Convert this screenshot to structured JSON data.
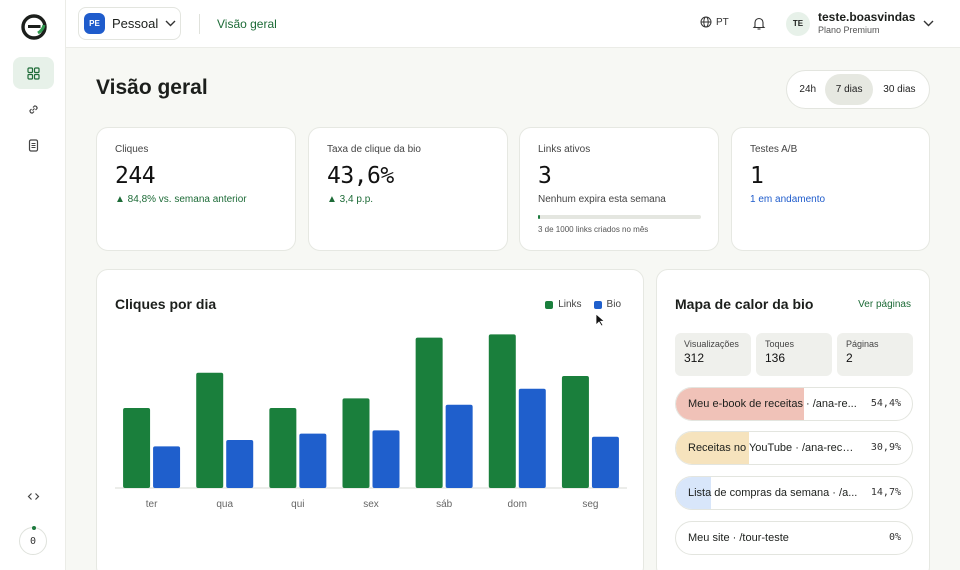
{
  "workspace": {
    "badge": "PE",
    "name": "Pessoal"
  },
  "breadcrumb": "Visão geral",
  "language": "PT",
  "user": {
    "initials": "TE",
    "username": "teste.boasvindas",
    "plan": "Plano Premium"
  },
  "sidebar": {
    "counter": "0"
  },
  "page": {
    "title": "Visão geral"
  },
  "range": {
    "options": [
      "24h",
      "7 dias",
      "30 dias"
    ],
    "selected": "7 dias"
  },
  "stats": [
    {
      "label": "Cliques",
      "value": "244",
      "sub": "▲ 84,8% vs. semana anterior"
    },
    {
      "label": "Taxa de clique da bio",
      "value": "43,6%",
      "sub": "▲ 3,4 p.p."
    },
    {
      "label": "Links ativos",
      "value": "3",
      "sub": "Nenhum expira esta semana",
      "progress": 0.003,
      "note": "3 de 1000 links criados no mês"
    },
    {
      "label": "Testes A/B",
      "value": "1",
      "sub": "1 em andamento"
    }
  ],
  "colors": {
    "links": "#1a7f3c",
    "bio": "#1f5fcc",
    "accent": "#1d6b37"
  },
  "chart_data": {
    "type": "bar",
    "title": "Cliques por dia",
    "categories": [
      "ter",
      "qua",
      "qui",
      "sex",
      "sáb",
      "dom",
      "seg"
    ],
    "series": [
      {
        "name": "Links",
        "values": [
          25,
          36,
          25,
          28,
          47,
          48,
          35
        ]
      },
      {
        "name": "Bio",
        "values": [
          13,
          15,
          17,
          18,
          26,
          31,
          16
        ]
      }
    ],
    "ylim": [
      0,
      50
    ],
    "grid": false,
    "legend": "top-right"
  },
  "heatmap": {
    "title": "Mapa de calor da bio",
    "link": "Ver páginas",
    "metrics": [
      {
        "label": "Visualizações",
        "value": "312"
      },
      {
        "label": "Toques",
        "value": "136"
      },
      {
        "label": "Páginas",
        "value": "2"
      }
    ],
    "rows": [
      {
        "label": "Meu e-book de receitas · /ana-re...",
        "pct": "54,4%",
        "share": 0.544,
        "color": "#f0c2b8"
      },
      {
        "label": "Receitas no YouTube · /ana-recei...",
        "pct": "30,9%",
        "share": 0.309,
        "color": "#f6e3bd"
      },
      {
        "label": "Lista de compras da semana · /a...",
        "pct": "14,7%",
        "share": 0.147,
        "color": "#d8e6fa"
      },
      {
        "label": "Meu site · /tour-teste",
        "pct": "0%",
        "share": 0,
        "color": "#ffffff"
      }
    ]
  }
}
